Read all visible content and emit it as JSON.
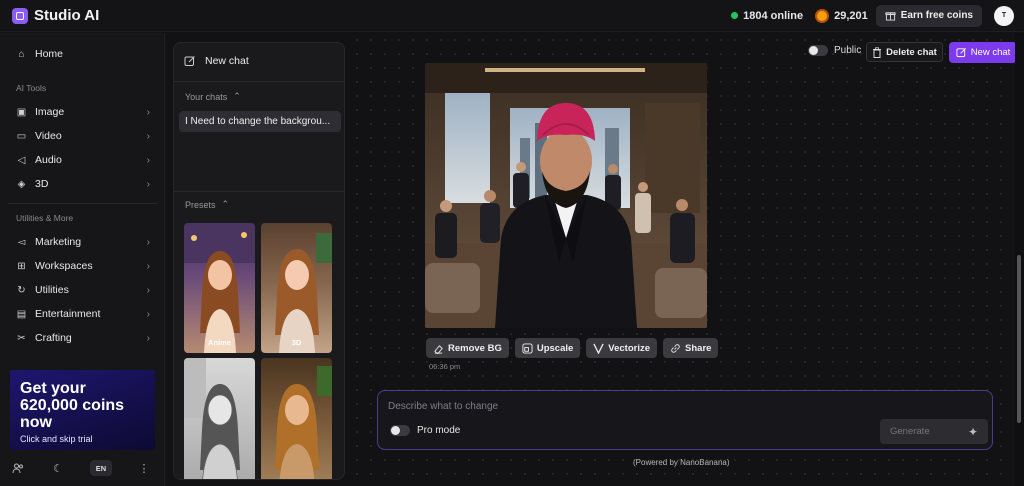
{
  "app": {
    "title": "Studio AI"
  },
  "topbar": {
    "online_count": "1804 online",
    "coins": "29,201",
    "earn_label": "Earn free coins",
    "avatar_text": "T"
  },
  "sidebar": {
    "home": "Home",
    "ai_tools_label": "AI Tools",
    "ai_tools": [
      {
        "label": "Image",
        "icon": "image-icon"
      },
      {
        "label": "Video",
        "icon": "video-icon"
      },
      {
        "label": "Audio",
        "icon": "audio-icon"
      },
      {
        "label": "3D",
        "icon": "cube-icon"
      }
    ],
    "utilities_label": "Utilities & More",
    "utilities": [
      {
        "label": "Marketing",
        "icon": "megaphone-icon"
      },
      {
        "label": "Workspaces",
        "icon": "grid-icon"
      },
      {
        "label": "Utilities",
        "icon": "utilities-icon"
      },
      {
        "label": "Entertainment",
        "icon": "entertainment-icon"
      },
      {
        "label": "Crafting",
        "icon": "scissors-icon"
      }
    ],
    "promo": {
      "title": "Get your 620,000 coins now",
      "subtitle": "Click and skip trial"
    },
    "lang": "EN"
  },
  "chat_panel": {
    "new_chat": "New chat",
    "your_chats_label": "Your chats",
    "chats": [
      "I Need to change the backgrou..."
    ],
    "presets_label": "Presets",
    "presets": [
      {
        "label": "Anime"
      },
      {
        "label": "3D"
      },
      {
        "label": ""
      },
      {
        "label": ""
      }
    ]
  },
  "toolbar": {
    "public_label": "Public",
    "delete_label": "Delete chat",
    "new_chat_label": "New chat"
  },
  "result": {
    "actions": [
      "Remove BG",
      "Upscale",
      "Vectorize",
      "Share"
    ],
    "time": "06:36 pm"
  },
  "prompt": {
    "placeholder": "Describe what to change",
    "pro_mode": "Pro mode",
    "generate": "Generate",
    "powered": "(Powered by NanoBanana)"
  },
  "colors": {
    "accent": "#7c3aed",
    "online": "#22c55e",
    "coin": "#f59e0b"
  }
}
